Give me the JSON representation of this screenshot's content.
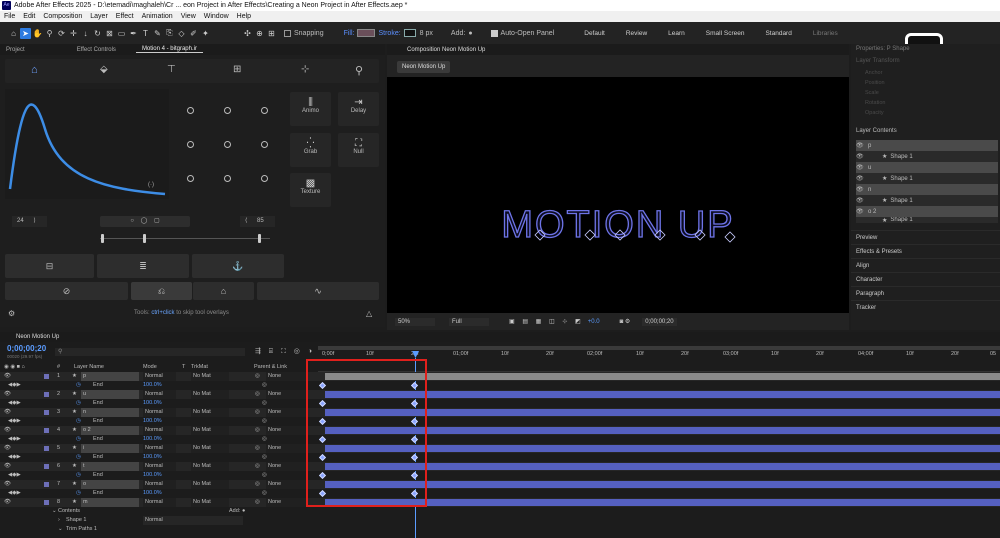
{
  "title": "Adobe After Effects 2025 - D:\\etemadi\\maghaleh\\Cr ... eon Project in After Effects\\Creating a Neon Project in After Effects.aep *",
  "app_icon": "Ae",
  "menu": [
    "File",
    "Edit",
    "Composition",
    "Layer",
    "Effect",
    "Animation",
    "View",
    "Window",
    "Help"
  ],
  "toolbar": {
    "snapping": "Snapping",
    "fill": "Fill:",
    "stroke": "Stroke:",
    "stroke_size": "8 px",
    "add": "Add:",
    "auto_open": "Auto-Open Panel",
    "workspaces": [
      "Default",
      "Review",
      "Learn",
      "Small Screen",
      "Standard",
      "Libraries"
    ]
  },
  "left_tabs": [
    "Project",
    "Effect Controls",
    "Motion 4 - bitgraph.ir"
  ],
  "motion": {
    "anim_label": "Animo",
    "delay_label": "Delay",
    "grab_label": "Grab",
    "null_label": "Null",
    "texture_label": "Texture",
    "left_value": "24",
    "right_value": "85",
    "hint_prefix": "Tools:",
    "hint_key": "ctrl+click",
    "hint_suffix": "to skip tool overlays"
  },
  "comp": {
    "tab": "Composition Neon Motion Up",
    "subtab": "Neon Motion Up",
    "headline": "MOTION UP",
    "zoom": "50%",
    "quality": "Full",
    "exposure": "+0.0",
    "timecode": "0;00;00;20"
  },
  "right_panel": {
    "top_tab": "Properties: P Shape",
    "sub": "Layer Transform",
    "props": [
      "Anchor",
      "Position",
      "Scale",
      "Rotation",
      "Opacity"
    ],
    "layer_contents": "Layer Contents",
    "tree": [
      {
        "name": "p",
        "type": "layer"
      },
      {
        "name": "Shape 1",
        "type": "shape"
      },
      {
        "name": "u",
        "type": "layer"
      },
      {
        "name": "Shape 1",
        "type": "shape"
      },
      {
        "name": "n",
        "type": "layer"
      },
      {
        "name": "Shape 1",
        "type": "shape"
      },
      {
        "name": "o 2",
        "type": "layer"
      },
      {
        "name": "Shape 1",
        "type": "shape"
      }
    ],
    "sections": [
      "Preview",
      "Effects & Presets",
      "Align",
      "Character",
      "Paragraph",
      "Tracker"
    ]
  },
  "timeline": {
    "tab": "Neon Motion Up",
    "timecode": "0;00;00;20",
    "fps": "00020 (29.97 fps)",
    "headers": {
      "num": "#",
      "layer_name": "Layer Name",
      "mode": "Mode",
      "t": "T",
      "trkmat": "TrkMat",
      "parent": "Parent & Link"
    },
    "ruler": [
      "0;00f",
      "10f",
      "20f",
      "01;00f",
      "10f",
      "20f",
      "02;00f",
      "10f",
      "20f",
      "03;00f",
      "10f",
      "20f",
      "04;00f",
      "10f",
      "20f",
      "05"
    ],
    "layers": [
      {
        "num": "1",
        "name": "p",
        "mode": "Normal",
        "trk": "No Mat",
        "parent": "None"
      },
      {
        "num": "2",
        "name": "u",
        "mode": "Normal",
        "trk": "No Mat",
        "parent": "None"
      },
      {
        "num": "3",
        "name": "n",
        "mode": "Normal",
        "trk": "No Mat",
        "parent": "None"
      },
      {
        "num": "4",
        "name": "o 2",
        "mode": "Normal",
        "trk": "No Mat",
        "parent": "None"
      },
      {
        "num": "5",
        "name": "i",
        "mode": "Normal",
        "trk": "No Mat",
        "parent": "None"
      },
      {
        "num": "6",
        "name": "t",
        "mode": "Normal",
        "trk": "No Mat",
        "parent": "None"
      },
      {
        "num": "7",
        "name": "o",
        "mode": "Normal",
        "trk": "No Mat",
        "parent": "None"
      },
      {
        "num": "8",
        "name": "m",
        "mode": "Normal",
        "trk": "No Mat",
        "parent": "None"
      }
    ],
    "end_label": "End",
    "end_value": "100.0%",
    "contents": "Contents",
    "add": "Add:",
    "shape1": "Shape 1",
    "shape1_mode": "Normal",
    "trim": "Trim Paths 1"
  },
  "colors": {
    "accent": "#2d7be0",
    "layer_bar": "#5560c0",
    "highlight_box": "#e0201c",
    "neon": "#6e74e8"
  }
}
